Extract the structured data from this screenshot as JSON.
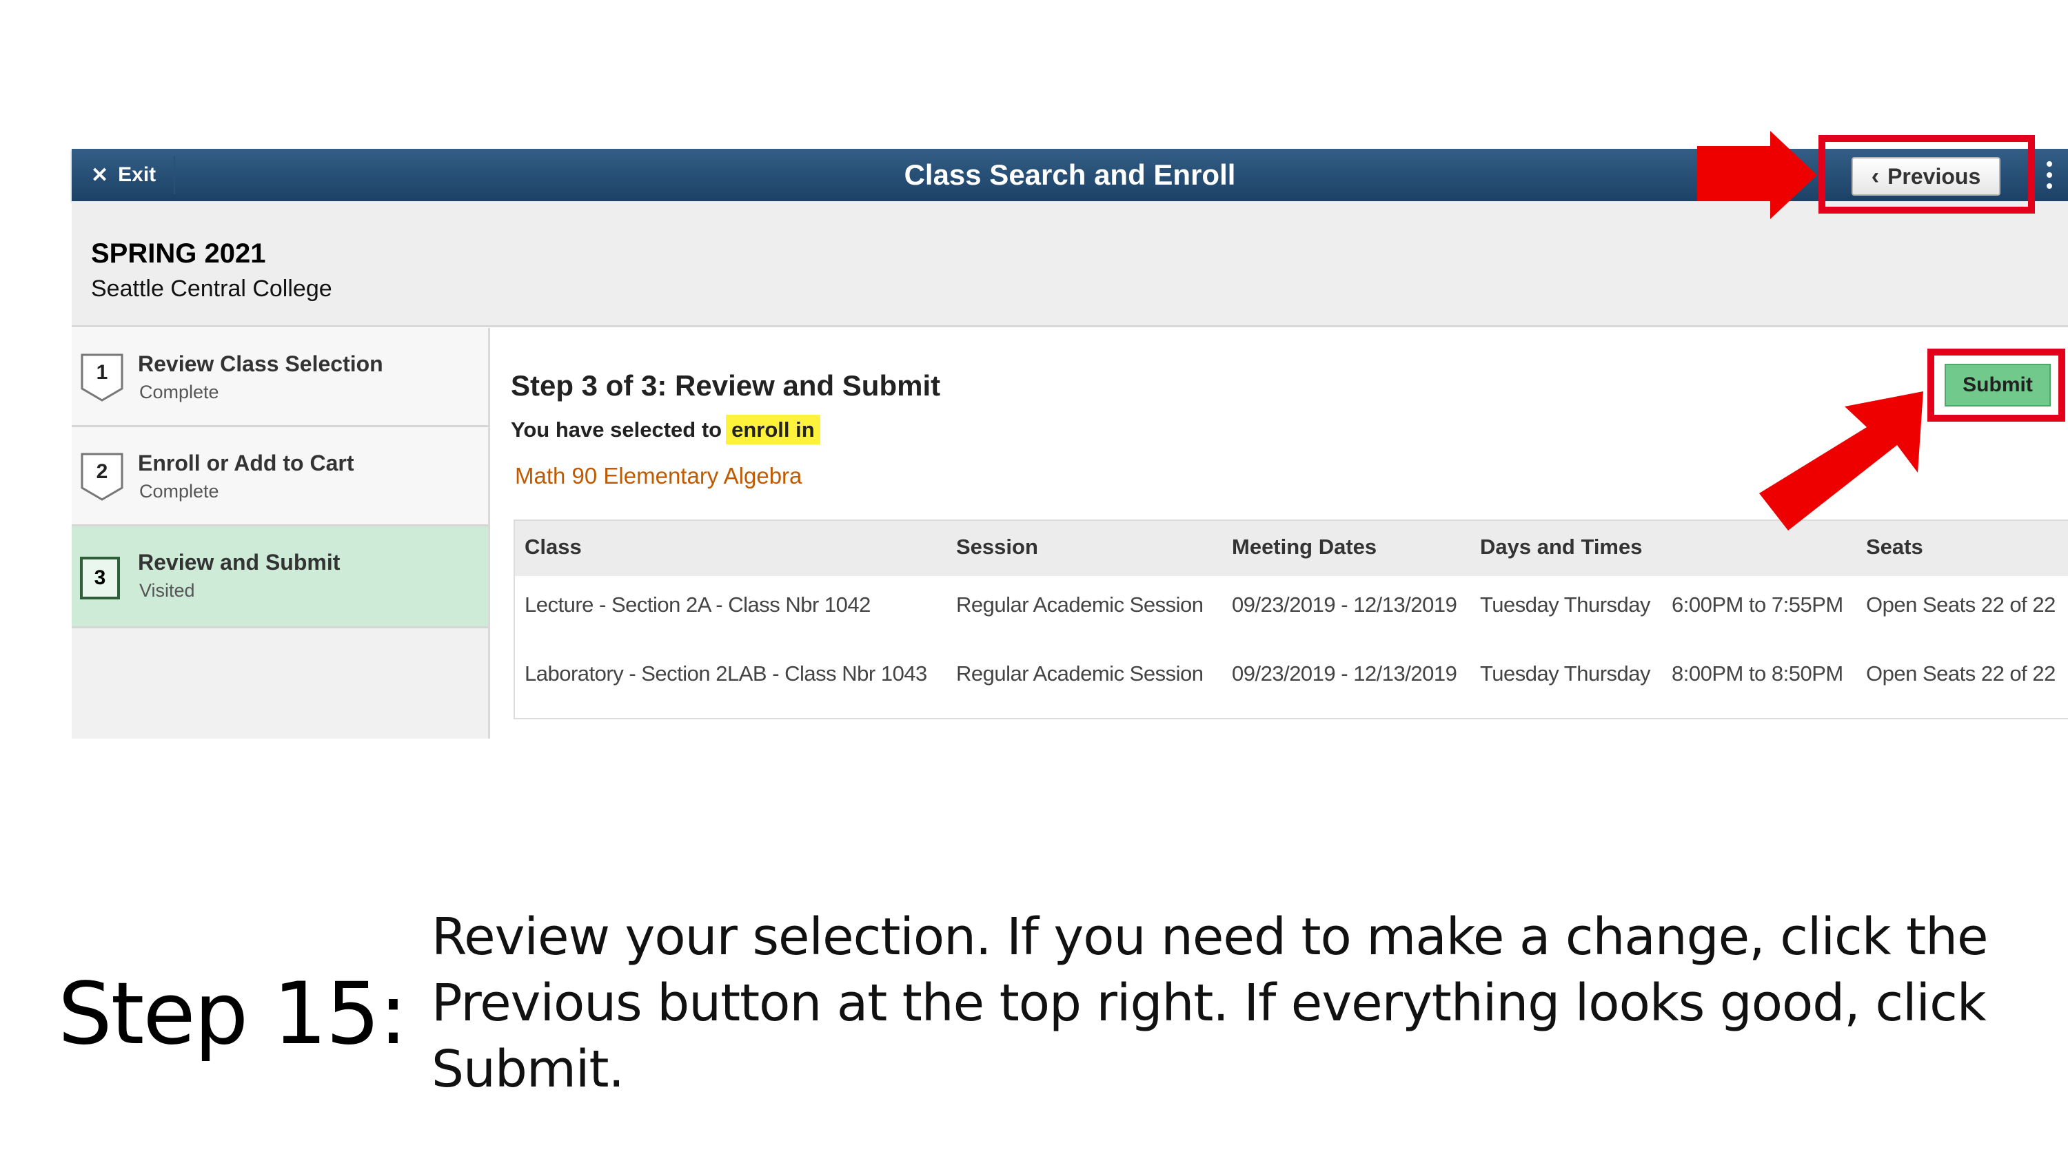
{
  "app": {
    "exit_label": "Exit",
    "title": "Class Search and Enroll",
    "previous_label": "Previous"
  },
  "term": {
    "name": "SPRING 2021",
    "institution": "Seattle Central College"
  },
  "steps": [
    {
      "number": "1",
      "title": "Review Class Selection",
      "status": "Complete"
    },
    {
      "number": "2",
      "title": "Enroll or Add to Cart",
      "status": "Complete"
    },
    {
      "number": "3",
      "title": "Review and Submit",
      "status": "Visited"
    }
  ],
  "main": {
    "heading": "Step 3 of 3: Review and Submit",
    "selected_prefix": "You have selected to",
    "selected_action": "enroll in",
    "course": "Math 90  Elementary Algebra",
    "submit_label": "Submit"
  },
  "table": {
    "headers": [
      "Class",
      "Session",
      "Meeting Dates",
      "Days and Times",
      "Seats"
    ],
    "rows": [
      {
        "class": "Lecture - Section 2A - Class Nbr 1042",
        "session": "Regular Academic Session",
        "dates": "09/23/2019 - 12/13/2019",
        "days": "Tuesday Thursday",
        "times": "6:00PM to 7:55PM",
        "seats": "Open Seats 22 of 22"
      },
      {
        "class": "Laboratory - Section 2LAB - Class Nbr 1043",
        "session": "Regular Academic Session",
        "dates": "09/23/2019 - 12/13/2019",
        "days": "Tuesday Thursday",
        "times": "8:00PM to 8:50PM",
        "seats": "Open Seats 22 of 22"
      }
    ]
  },
  "caption": {
    "step_label": "Step 15:",
    "text_1": "Review your selection. If you need to make a change, click the ",
    "previous_word": "Previous",
    "text_2": " button at the top right. If everything looks good, click ",
    "submit_word": "Submit",
    "text_3": "."
  },
  "colors": {
    "topbar": "#1c4166",
    "highlight": "#fff23a",
    "course_text": "#c05a00",
    "submit_button": "#71c98b",
    "active_step": "#cdebd7",
    "annotation": "#e2001a"
  }
}
